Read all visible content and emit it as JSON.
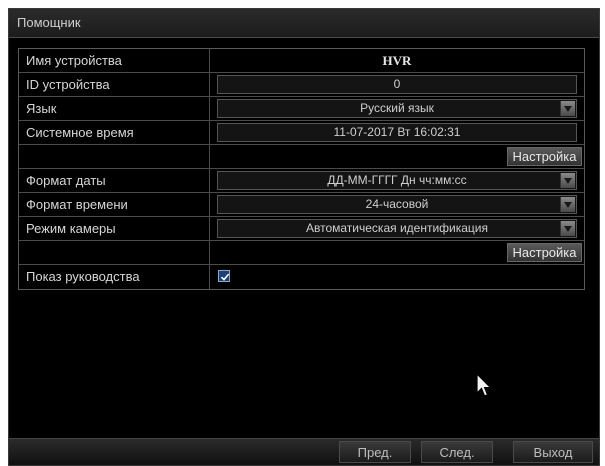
{
  "window": {
    "title": "Помощник"
  },
  "settings": {
    "device_name": {
      "label": "Имя устройства",
      "value": "HVR"
    },
    "device_id": {
      "label": "ID устройства",
      "value": "0"
    },
    "language": {
      "label": "Язык",
      "value": "Русский язык"
    },
    "system_time": {
      "label": "Системное время",
      "value": "11-07-2017 Вт 16:02:31"
    },
    "time_setup_button": "Настройка",
    "date_format": {
      "label": "Формат даты",
      "value": "ДД-ММ-ГГГГ Дн чч:мм:сс"
    },
    "time_format": {
      "label": "Формат времени",
      "value": "24-часовой"
    },
    "camera_mode": {
      "label": "Режим камеры",
      "value": "Автоматическая идентификация"
    },
    "camera_setup_button": "Настройка",
    "show_guide": {
      "label": "Показ руководства",
      "checked": true
    }
  },
  "footer": {
    "prev": "Пред.",
    "next": "След.",
    "exit": "Выход"
  },
  "icons": {
    "dropdown": "chevron-down-icon",
    "checkbox": "checkmark-icon",
    "cursor": "mouse-pointer-icon"
  }
}
